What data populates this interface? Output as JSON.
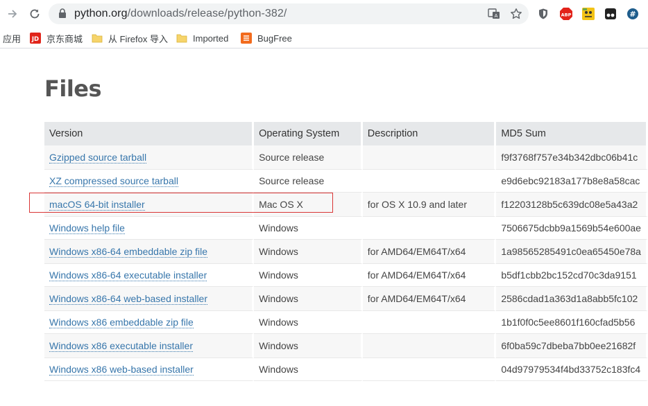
{
  "browser": {
    "url_host": "python.org",
    "url_path": "/downloads/release/python-382/"
  },
  "bookmarks": [
    {
      "label": "应用",
      "icon": "apps-grid-icon"
    },
    {
      "label": "京东商城",
      "icon": "jd-icon"
    },
    {
      "label": "从 Firefox 导入",
      "icon": "folder-icon"
    },
    {
      "label": "Imported",
      "icon": "folder-icon"
    },
    {
      "label": "BugFree",
      "icon": "bugfree-icon"
    }
  ],
  "page": {
    "title": "Files"
  },
  "table": {
    "headers": [
      "Version",
      "Operating System",
      "Description",
      "MD5 Sum"
    ],
    "rows": [
      {
        "version": "Gzipped source tarball",
        "os": "Source release",
        "description": "",
        "md5": "f9f3768f757e34b342dbc06b41c"
      },
      {
        "version": "XZ compressed source tarball",
        "os": "Source release",
        "description": "",
        "md5": "e9d6ebc92183a177b8e8a58cac"
      },
      {
        "version": "macOS 64-bit installer",
        "os": "Mac OS X",
        "description": "for OS X 10.9 and later",
        "md5": "f12203128b5c639dc08e5a43a2"
      },
      {
        "version": "Windows help file",
        "os": "Windows",
        "description": "",
        "md5": "7506675dcbb9a1569b54e600ae"
      },
      {
        "version": "Windows x86-64 embeddable zip file",
        "os": "Windows",
        "description": "for AMD64/EM64T/x64",
        "md5": "1a98565285491c0ea65450e78a"
      },
      {
        "version": "Windows x86-64 executable installer",
        "os": "Windows",
        "description": "for AMD64/EM64T/x64",
        "md5": "b5df1cbb2bc152cd70c3da9151"
      },
      {
        "version": "Windows x86-64 web-based installer",
        "os": "Windows",
        "description": "for AMD64/EM64T/x64",
        "md5": "2586cdad1a363d1a8abb5fc102"
      },
      {
        "version": "Windows x86 embeddable zip file",
        "os": "Windows",
        "description": "",
        "md5": "1b1f0f0c5ee8601f160cfad5b56"
      },
      {
        "version": "Windows x86 executable installer",
        "os": "Windows",
        "description": "",
        "md5": "6f0ba59c7dbeba7bb0ee21682f"
      },
      {
        "version": "Windows x86 web-based installer",
        "os": "Windows",
        "description": "",
        "md5": "04d97979534f4bd33752c183fc4"
      }
    ]
  },
  "colors": {
    "link": "#3776ab",
    "highlight_border": "#d93535",
    "header_bg": "#e6e8ea"
  }
}
